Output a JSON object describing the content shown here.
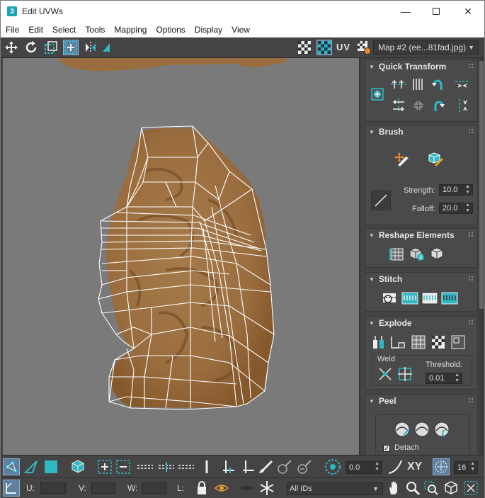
{
  "window": {
    "title": "Edit UVWs",
    "app_icon": "3",
    "controls": [
      "minimize-icon",
      "maximize-icon",
      "close-icon"
    ]
  },
  "menu": [
    "File",
    "Edit",
    "Select",
    "Tools",
    "Mapping",
    "Options",
    "Display",
    "View"
  ],
  "toolbar": {
    "uv_label": "UV",
    "map_select": "Map #2 (ee...81fad.jpg)"
  },
  "quick_transform": {
    "title": "Quick Transform"
  },
  "brush": {
    "title": "Brush",
    "strength_label": "Strength:",
    "strength_value": "10.0",
    "falloff_label": "Falloff:",
    "falloff_value": "20.0"
  },
  "reshape": {
    "title": "Reshape Elements"
  },
  "stitch": {
    "title": "Stitch"
  },
  "explode": {
    "title": "Explode",
    "weld_label": "Weld",
    "threshold_label": "Threshold:",
    "threshold_value": "0.01"
  },
  "peel": {
    "title": "Peel",
    "detach_label": "Detach",
    "detach_checked": true
  },
  "bottom": {
    "rotate_value": "0.0",
    "xy_label": "XY",
    "grid_value": "16",
    "u_label": "U:",
    "v_label": "V:",
    "w_label": "W:",
    "l_label": "L:",
    "ids_value": "All IDs"
  },
  "colors": {
    "accent": "#2fb8c4",
    "panel": "#444444",
    "viewport": "#7a7a7a"
  }
}
